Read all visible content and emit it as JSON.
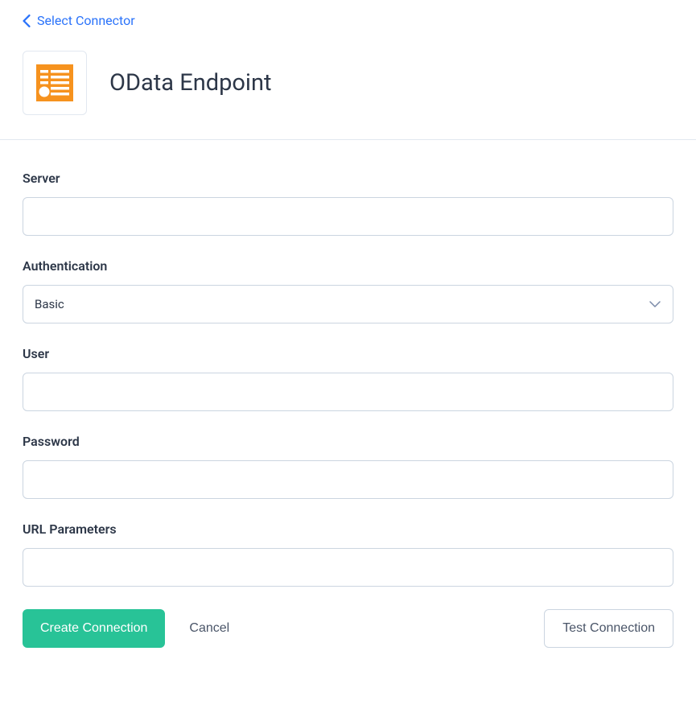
{
  "nav": {
    "back_label": "Select Connector"
  },
  "header": {
    "title": "OData Endpoint"
  },
  "form": {
    "server": {
      "label": "Server",
      "value": ""
    },
    "authentication": {
      "label": "Authentication",
      "selected": "Basic"
    },
    "user": {
      "label": "User",
      "value": ""
    },
    "password": {
      "label": "Password",
      "value": ""
    },
    "url_parameters": {
      "label": "URL Parameters",
      "value": ""
    }
  },
  "buttons": {
    "create": "Create Connection",
    "cancel": "Cancel",
    "test": "Test Connection"
  },
  "colors": {
    "accent_blue": "#2972fa",
    "accent_green": "#28c397",
    "icon_orange": "#f6921e"
  }
}
